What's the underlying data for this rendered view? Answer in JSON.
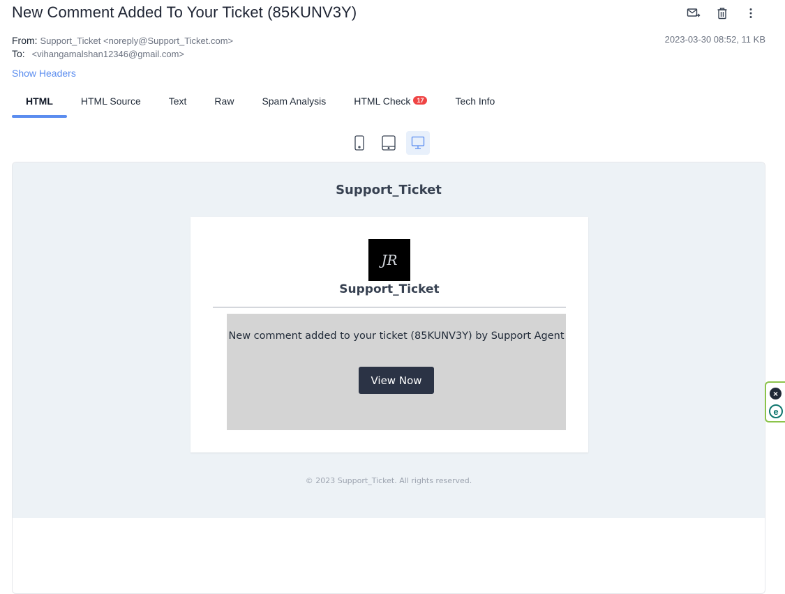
{
  "email": {
    "subject": "New Comment Added To Your Ticket (85KUNV3Y)",
    "from_label": "From:",
    "from_value": "Support_Ticket <noreply@Support_Ticket.com>",
    "to_label": "To:",
    "to_value": "<vihangamalshan12346@gmail.com>",
    "date_size": "2023-03-30 08:52, 11 KB",
    "show_headers": "Show Headers"
  },
  "actions": {
    "icons": [
      "forward-mail-icon",
      "trash-icon",
      "more-vertical-icon"
    ]
  },
  "tabs": [
    {
      "label": "HTML",
      "active": true
    },
    {
      "label": "HTML Source"
    },
    {
      "label": "Text"
    },
    {
      "label": "Raw"
    },
    {
      "label": "Spam Analysis"
    },
    {
      "label": "HTML Check",
      "badge": "17"
    },
    {
      "label": "Tech Info"
    }
  ],
  "devices": [
    "phone-icon",
    "tablet-icon",
    "desktop-icon"
  ],
  "preview": {
    "brand_top": "Support_Ticket",
    "logo_text": "JR",
    "card_name": "Support_Ticket",
    "message": "New comment added to your ticket (85KUNV3Y) by Support Agent",
    "button": "View Now",
    "footer": "© 2023 Support_Ticket. All rights reserved."
  },
  "colors": {
    "accent": "#5b8def",
    "badge": "#ef4444",
    "button_bg": "#2b3345",
    "preview_bg": "#edf2f6",
    "message_box": "#d4d4d4"
  }
}
